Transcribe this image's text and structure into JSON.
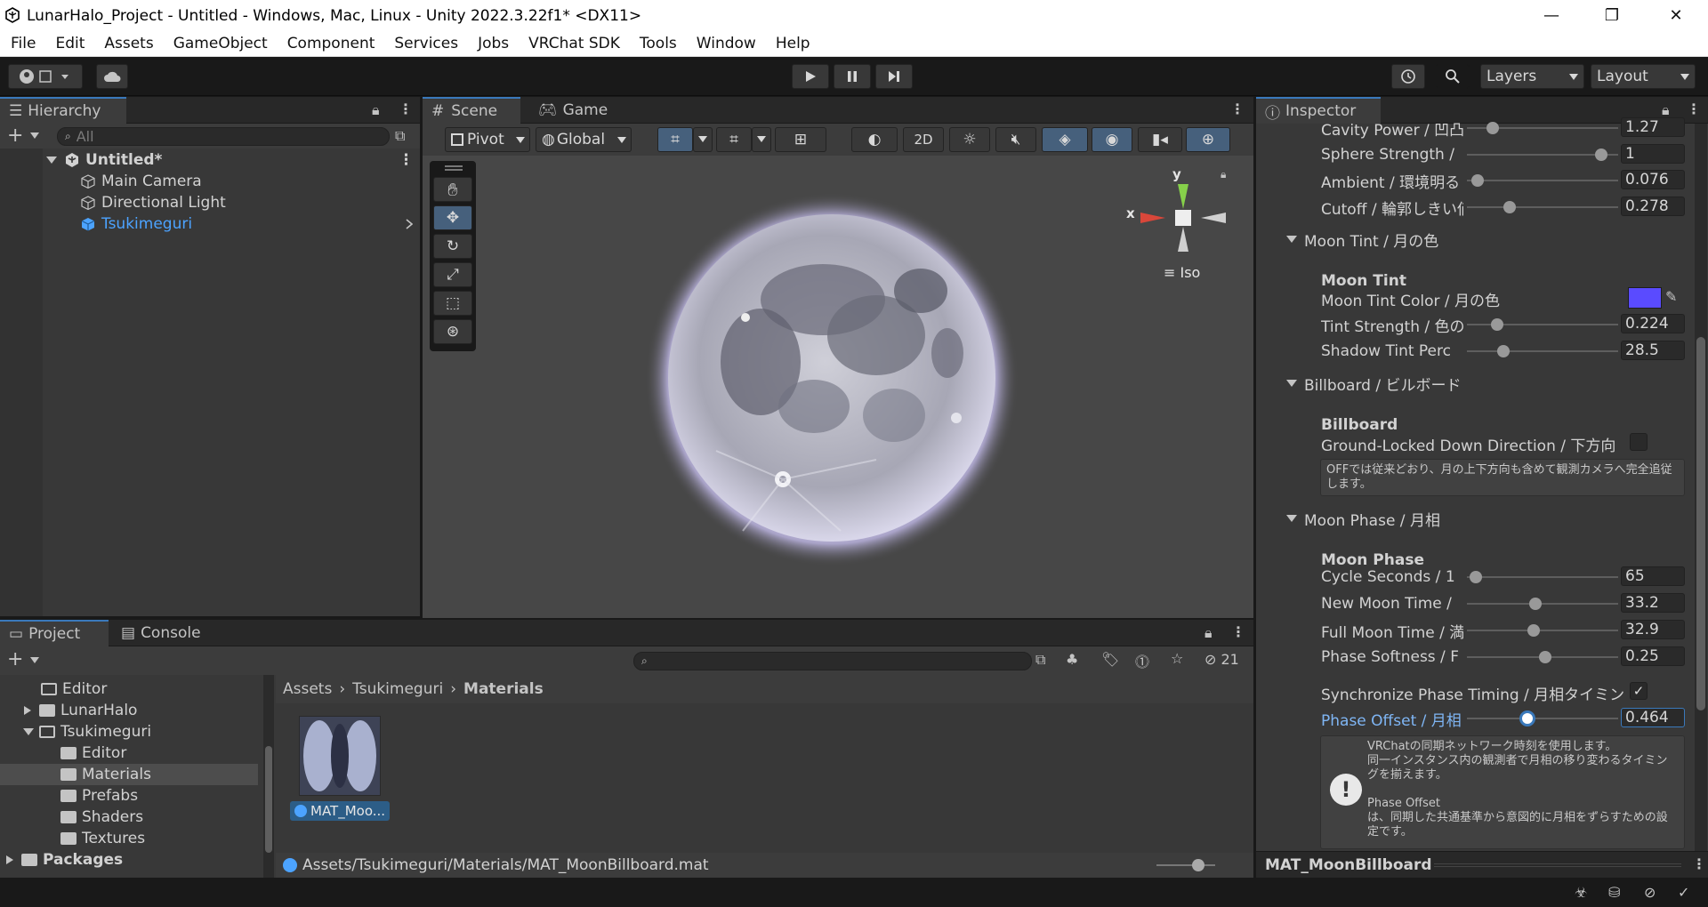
{
  "window": {
    "title": "LunarHalo_Project - Untitled - Windows, Mac, Linux - Unity 2022.3.22f1* <DX11>",
    "minimize": "—",
    "maximize": "❐",
    "close": "✕"
  },
  "menu": [
    "File",
    "Edit",
    "Assets",
    "GameObject",
    "Component",
    "Services",
    "Jobs",
    "VRChat SDK",
    "Tools",
    "Window",
    "Help"
  ],
  "toolbar": {
    "layers_label": "Layers",
    "layout_label": "Layout"
  },
  "hierarchy": {
    "tab": "Hierarchy",
    "search_placeholder": "All",
    "scene_name": "Untitled*",
    "items": [
      "Main Camera",
      "Directional Light",
      "Tsukimeguri"
    ]
  },
  "scene_view": {
    "tab_scene": "Scene",
    "tab_game": "Game",
    "pivot": "Pivot",
    "global": "Global",
    "mode_2d": "2D",
    "gizmo_x": "x",
    "gizmo_y": "y",
    "iso": "Iso"
  },
  "inspector": {
    "tab": "Inspector",
    "rows_top": [
      {
        "label": "Cavity Power / 凹凸",
        "value": "1.27",
        "knob": 0.17
      },
      {
        "label": "Sphere Strength / ",
        "value": "1",
        "knob": 0.89
      },
      {
        "label": "Ambient / 環境明る",
        "value": "0.076",
        "knob": 0.07
      },
      {
        "label": "Cutoff / 輪郭しきい値",
        "value": "0.278",
        "knob": 0.28
      }
    ],
    "moon_tint": {
      "section": "Moon Tint / 月の色",
      "header": "Moon Tint",
      "color_label": "Moon Tint Color / 月の色",
      "color": "#5a4bff",
      "tint_strength_label": "Tint Strength / 色の",
      "tint_strength": "0.224",
      "tint_knob": 0.2,
      "shadow_label": "Shadow Tint Perc",
      "shadow_value": "28.5",
      "shadow_knob": 0.24
    },
    "billboard": {
      "section": "Billboard / ビルボード",
      "header": "Billboard",
      "ground_label": "Ground-Locked Down Direction / 下方向",
      "help": "OFFでは従来どおり、月の上下方向も含めて観測カメラへ完全追従します。"
    },
    "moon_phase": {
      "section": "Moon Phase / 月相",
      "header": "Moon Phase",
      "rows": [
        {
          "label": "Cycle Seconds / 1",
          "value": "65",
          "knob": 0.06
        },
        {
          "label": "New Moon Time / ",
          "value": "33.2",
          "knob": 0.45
        },
        {
          "label": "Full Moon Time / 満",
          "value": "32.9",
          "knob": 0.44
        },
        {
          "label": "Phase Softness / F",
          "value": "0.25",
          "knob": 0.52
        }
      ],
      "sync_label": "Synchronize Phase Timing / 月相タイミング",
      "offset_label": "Phase Offset / 月相",
      "offset_value": "0.464",
      "offset_knob": 0.4,
      "help_lines": [
        "VRChatの同期ネットワーク時刻を使用します。",
        "同一インスタンス内の観測者で月相の移り変わるタイミングを揃えます。",
        "",
        "Phase Offset",
        "は、同期した共通基準から意図的に月相をずらすための設定です。"
      ]
    },
    "footer": "MAT_MoonBillboard"
  },
  "project": {
    "tab_project": "Project",
    "tab_console": "Console",
    "hidden_count": "21",
    "tree": [
      "Editor",
      "LunarHalo",
      "Tsukimeguri",
      "Editor",
      "Materials",
      "Prefabs",
      "Shaders",
      "Textures",
      "Packages"
    ],
    "breadcrumb": [
      "Assets",
      "Tsukimeguri",
      "Materials"
    ],
    "asset_name": "MAT_Moo...",
    "path": "Assets/Tsukimeguri/Materials/MAT_MoonBillboard.mat"
  },
  "colors": {
    "accent": "#3a79bb",
    "selected_text": "#4ca3ff",
    "moon_glow": "#d8d2ff"
  }
}
